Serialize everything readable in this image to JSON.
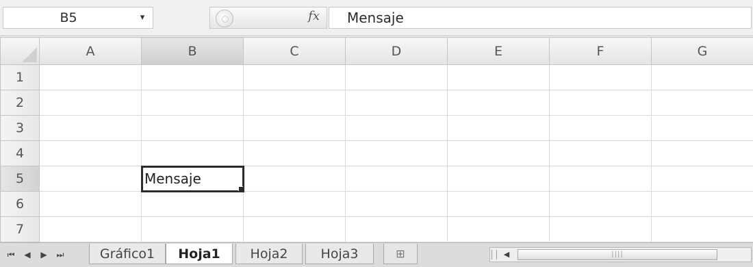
{
  "formula_bar": {
    "name_box": "B5",
    "name_box_arrow": "▾",
    "fx_label": "fx",
    "formula": "Mensaje"
  },
  "grid": {
    "columns": [
      "A",
      "B",
      "C",
      "D",
      "E",
      "F",
      "G"
    ],
    "rows": [
      "1",
      "2",
      "3",
      "4",
      "5",
      "6",
      "7"
    ],
    "active_cell": "B5",
    "active_cell_value": "Mensaje"
  },
  "tabs": {
    "nav": {
      "first": "⏮",
      "prev": "◀",
      "next": "▶",
      "last": "⏭"
    },
    "items": [
      "Gráfico1",
      "Hoja1",
      "Hoja2",
      "Hoja3"
    ],
    "active": "Hoja1",
    "insert_icon": "⊞"
  },
  "scrollbar": {
    "left_arrow": "◀",
    "thumb_grip": "||||"
  }
}
